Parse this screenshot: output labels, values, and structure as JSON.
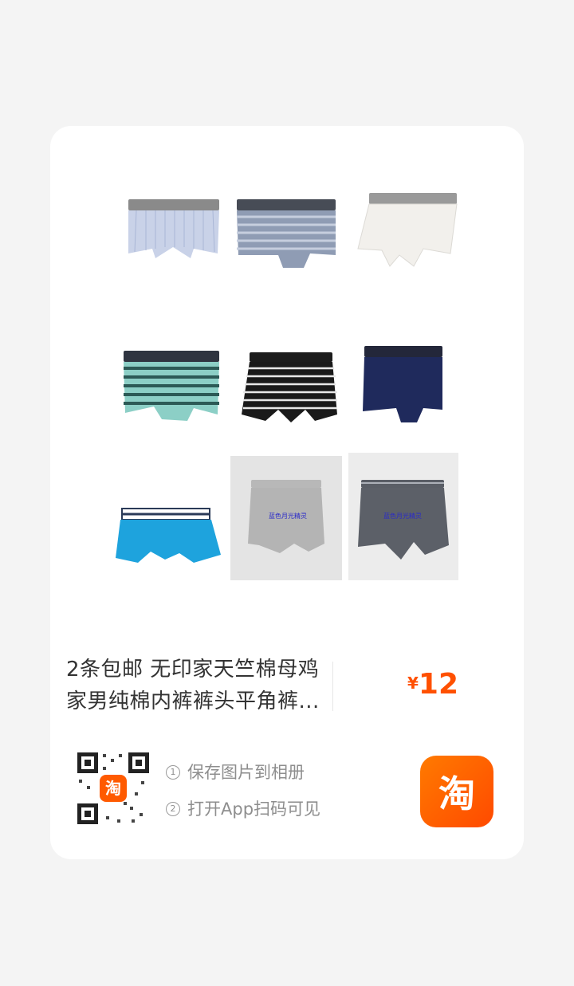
{
  "product": {
    "title": "2条包邮 无印家天竺棉母鸡家男纯棉内裤裤头平角裤...",
    "price_symbol": "¥",
    "price_value": "12"
  },
  "steps": [
    {
      "num": "1",
      "label": "保存图片到相册"
    },
    {
      "num": "2",
      "label": "打开App扫码可见"
    }
  ],
  "watermark": "蓝色月光精灵",
  "app_logo_char": "淘",
  "colors": {
    "accent": "#ff5000",
    "card_bg": "#ffffff",
    "page_bg": "#f4f4f4"
  }
}
